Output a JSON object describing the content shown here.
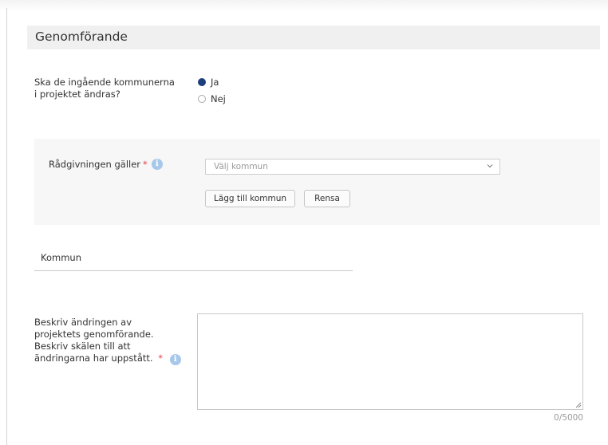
{
  "section": {
    "title": "Genomförande"
  },
  "question": {
    "label_line1": "Ska de ingående kommunerna",
    "label_line2": "i projektet ändras?",
    "options": [
      {
        "label": "Ja",
        "checked": true
      },
      {
        "label": "Nej",
        "checked": false
      }
    ]
  },
  "advice": {
    "label": "Rådgivningen gäller",
    "required_mark": "*",
    "info_glyph": "i",
    "select_placeholder": "Välj kommun",
    "add_button": "Lägg till kommun",
    "clear_button": "Rensa"
  },
  "kommun_table": {
    "heading": "Kommun"
  },
  "description": {
    "label_lines": [
      "Beskriv ändringen av",
      "projektets genomförande.",
      "Beskriv skälen till att",
      "ändringarna har uppstått."
    ],
    "required_mark": "*",
    "info_glyph": "i",
    "value": "",
    "counter": "0/5000"
  },
  "colors": {
    "accent": "#1f3f7a",
    "required": "#e0404a",
    "info": "#a7c8ea",
    "header_bg": "#f0f0f0",
    "panel_bg": "#f7f7f7"
  },
  "icons": {
    "info": "info-icon",
    "select_arrow": "chevron-down-icon",
    "resize": "resize-grip-icon"
  }
}
